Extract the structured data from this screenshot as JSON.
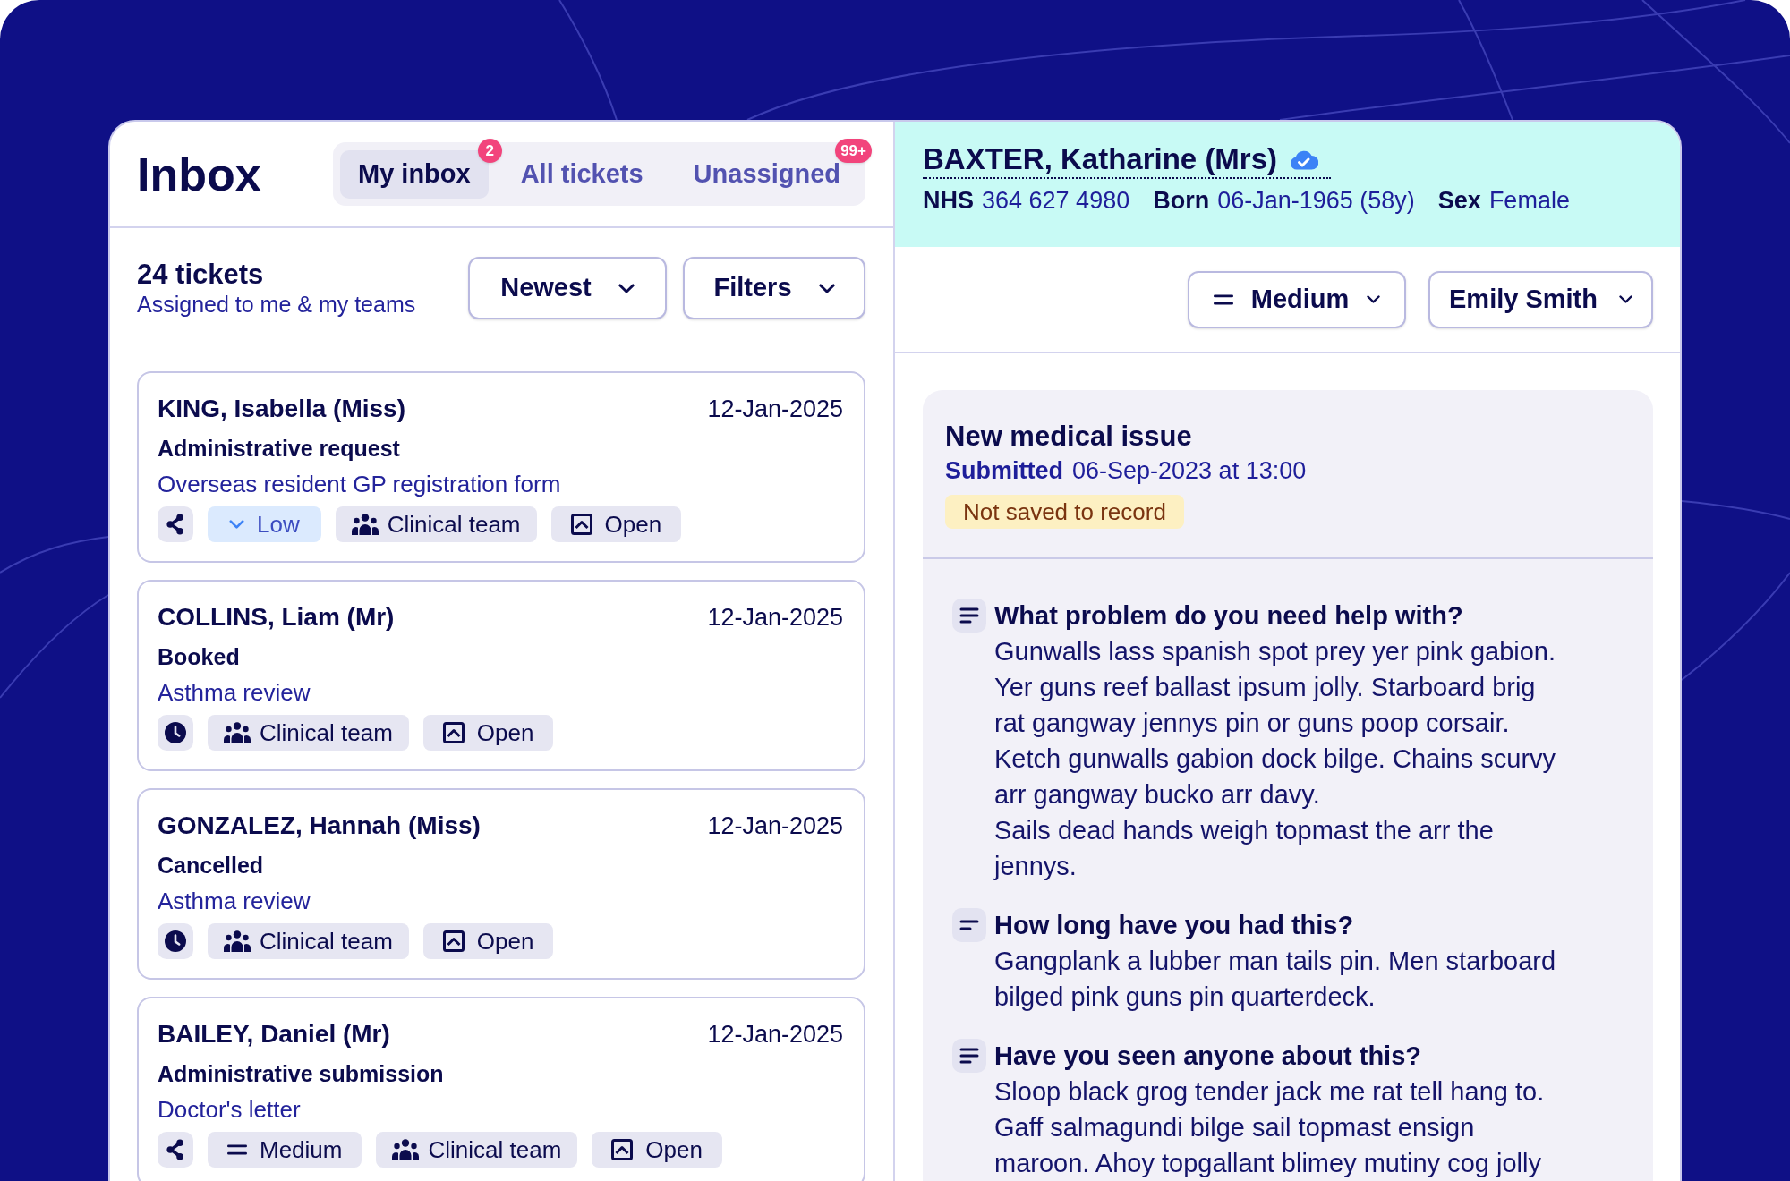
{
  "inbox": {
    "title": "Inbox",
    "tabs": [
      {
        "label": "My inbox",
        "selected": true,
        "badge": "2"
      },
      {
        "label": "All tickets",
        "selected": false
      },
      {
        "label": "Unassigned",
        "selected": false,
        "badge": "99+"
      }
    ]
  },
  "ticket_list": {
    "count": "24 tickets",
    "subtitle": "Assigned to me & my teams",
    "sort": "Newest",
    "filter": "Filters"
  },
  "tickets": [
    {
      "patient": "KING, Isabella (Miss)",
      "date": "12-Jan-2025",
      "type": "Administrative request",
      "description": "Overseas resident GP registration form",
      "chips": [
        {
          "kind": "share"
        },
        {
          "kind": "low",
          "label": "Low"
        },
        {
          "kind": "team",
          "label": "Clinical team"
        },
        {
          "kind": "status",
          "label": "Open"
        }
      ]
    },
    {
      "patient": "COLLINS, Liam (Mr)",
      "date": "12-Jan-2025",
      "type": "Booked",
      "description": "Asthma review",
      "chips": [
        {
          "kind": "clock"
        },
        {
          "kind": "team",
          "label": "Clinical team"
        },
        {
          "kind": "status",
          "label": "Open"
        }
      ]
    },
    {
      "patient": "GONZALEZ, Hannah (Miss)",
      "date": "12-Jan-2025",
      "type": "Cancelled",
      "description": "Asthma review",
      "chips": [
        {
          "kind": "clock"
        },
        {
          "kind": "team",
          "label": "Clinical team"
        },
        {
          "kind": "status",
          "label": "Open"
        }
      ]
    },
    {
      "patient": "BAILEY, Daniel (Mr)",
      "date": "12-Jan-2025",
      "type": "Administrative submission",
      "description": "Doctor's letter",
      "chips": [
        {
          "kind": "share"
        },
        {
          "kind": "medium",
          "label": "Medium"
        },
        {
          "kind": "team",
          "label": "Clinical team"
        },
        {
          "kind": "status",
          "label": "Open"
        }
      ]
    }
  ],
  "patient": {
    "name": "BAXTER, Katharine (Mrs)",
    "verified": true,
    "details": [
      {
        "label": "NHS",
        "value": "364 627 4980"
      },
      {
        "label": "Born",
        "value": "06-Jan-1965 (58y)"
      },
      {
        "label": "Sex",
        "value": "Female"
      }
    ]
  },
  "toolbar": {
    "priority": {
      "kind": "medium",
      "label": "Medium"
    },
    "assignee": "Emily Smith"
  },
  "submission": {
    "title": "New medical issue",
    "submitted_label": "Submitted",
    "submitted_at": "06-Sep-2023 at 13:00",
    "record_status": "Not saved to record",
    "questions": [
      {
        "kind": "paragraph",
        "question": "What problem do you need help with?",
        "answer": [
          "Gunwalls lass spanish spot prey yer pink gabion. Yer guns reef ballast ipsum jolly. Starboard brig rat gangway jennys pin or guns poop corsair. Ketch gunwalls gabion dock bilge. Chains scurvy arr gangway bucko arr davy.",
          "Sails dead hands weigh topmast the arr the jennys."
        ]
      },
      {
        "kind": "short",
        "question": "How long have you had this?",
        "answer": [
          "Gangplank a lubber man tails pin. Men starboard bilged pink guns pin quarterdeck."
        ]
      },
      {
        "kind": "paragraph",
        "question": "Have you seen anyone about this?",
        "answer": [
          "Sloop black grog tender jack me rat tell hang to. Gaff salmagundi bilge sail topmast ensign maroon. Ahoy topgallant blimey mutiny cog jolly"
        ]
      }
    ]
  }
}
